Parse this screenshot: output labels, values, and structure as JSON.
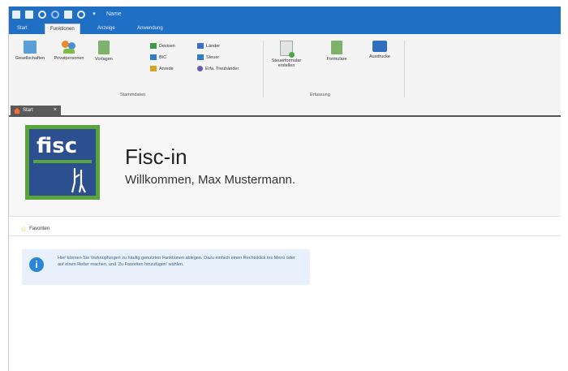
{
  "quick_access": {
    "icons": [
      "back-icon",
      "save-icon",
      "settings-icon",
      "refresh-icon",
      "delete-icon",
      "user-icon",
      "dropdown-icon"
    ],
    "title": "Name"
  },
  "ribbon_tabs": [
    {
      "label": "Start",
      "active": false
    },
    {
      "label": "Funktionen",
      "active": true
    },
    {
      "label": "Anzeige",
      "active": false
    },
    {
      "label": "Anwendung",
      "active": false
    }
  ],
  "ribbon": {
    "large_buttons_1": [
      {
        "label": "Gesellschaften",
        "icon": "company-icon"
      },
      {
        "label": "Privatpersonen",
        "icon": "persons-icon"
      },
      {
        "label": "Vorlagen",
        "icon": "template-icon"
      }
    ],
    "small_col1": [
      {
        "label": "Devisen",
        "icon": "currency-icon"
      },
      {
        "label": "BIC",
        "icon": "bank-icon"
      },
      {
        "label": "Anrede",
        "icon": "pen-icon"
      }
    ],
    "small_col2": [
      {
        "label": "Länder",
        "icon": "flag-icon"
      },
      {
        "label": "Steuer",
        "icon": "bank-icon"
      },
      {
        "label": "Erfa. Treuhänder",
        "icon": "gear-icon"
      }
    ],
    "group1_label": "Stammdaten",
    "large_buttons_2": [
      {
        "label": "Steuerformular erstellen",
        "icon": "form-icon"
      },
      {
        "label": "Formulare",
        "icon": "forms-icon"
      },
      {
        "label": "Ausdrucke",
        "icon": "printer-icon"
      }
    ],
    "group2_label": "Erfassung"
  },
  "doc_tab": {
    "label": "Start"
  },
  "welcome": {
    "logo_text": "fisc",
    "app_name": "Fisc-in",
    "greeting": "Willkommen, Max Mustermann."
  },
  "favorites": {
    "title": "Favoriten",
    "info": "Hier können Sie Verknüpfungen zu häufig genutzten Funktionen ablegen. Dazu einfach einen Rechtsklick ins Menü oder auf einen Reiter machen, und 'Zu Favoriten hinzufügen' wählen."
  },
  "colors": {
    "accent": "#1f6fc5",
    "logo_green": "#59a53a",
    "logo_blue": "#2b4f8f",
    "info_bg": "#e8f1fb"
  }
}
